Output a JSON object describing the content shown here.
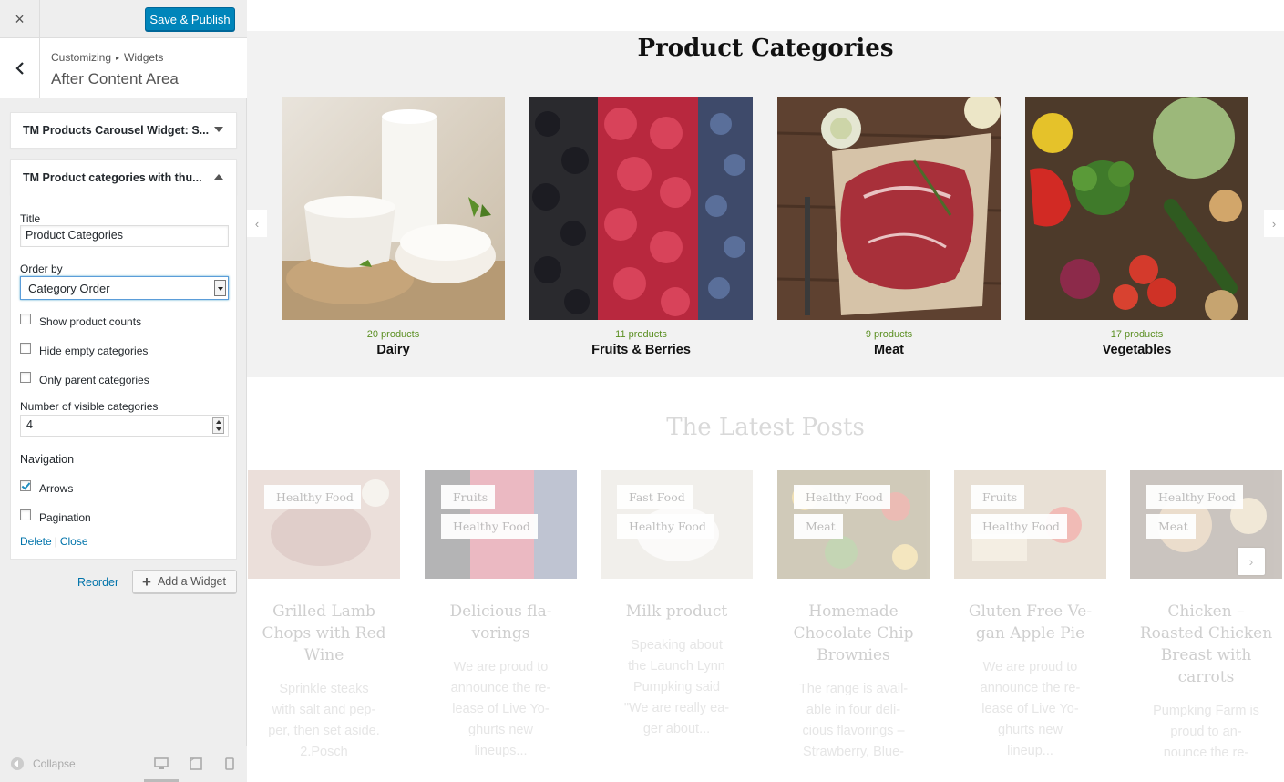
{
  "header": {
    "close_label": "×",
    "publish_label": "Save & Publish"
  },
  "breadcrumb": {
    "root": "Customizing",
    "separator": "▸",
    "current": "Widgets"
  },
  "section_title": "After Content Area",
  "widgets": [
    {
      "title": "TM Products Carousel Widget: S...",
      "state": "collapsed"
    },
    {
      "title": "TM Product categories with thu...",
      "state": "expanded"
    }
  ],
  "form": {
    "title_label": "Title",
    "title_value": "Product Categories",
    "order_label": "Order by",
    "order_value": "Category Order",
    "checkboxes": [
      {
        "label": "Show product counts",
        "checked": false
      },
      {
        "label": "Hide empty categories",
        "checked": false
      },
      {
        "label": "Only parent categories",
        "checked": false
      }
    ],
    "visible_label": "Number of visible categories",
    "visible_value": "4",
    "navigation_heading": "Navigation",
    "nav_checkboxes": [
      {
        "label": "Arrows",
        "checked": true
      },
      {
        "label": "Pagination",
        "checked": false
      }
    ],
    "delete_label": "Delete",
    "link_separator": "|",
    "close_label": "Close"
  },
  "actions": {
    "reorder_label": "Reorder",
    "add_widget_label": "Add a Widget"
  },
  "footer": {
    "collapse_label": "Collapse",
    "devices": [
      "desktop-icon",
      "tablet-icon",
      "mobile-icon"
    ]
  },
  "preview": {
    "categories_title": "Product Categories",
    "categories": [
      {
        "count": "20 products",
        "name": "Dairy",
        "image": "dairy-image"
      },
      {
        "count": "11 products",
        "name": "Fruits & Berries",
        "image": "berries-image"
      },
      {
        "count": "9 products",
        "name": "Meat",
        "image": "meat-image"
      },
      {
        "count": "17 products",
        "name": "Vegetables",
        "image": "vegetables-image"
      }
    ],
    "posts_title": "The Latest Posts",
    "posts": [
      {
        "tags": [
          "Healthy Food"
        ],
        "title": "Grilled Lamb Chops with Red Wine",
        "excerpt": "Sprinkle steaks with salt and pep-per, then set aside. 2.Posch"
      },
      {
        "tags": [
          "Fruits",
          "Healthy Food"
        ],
        "title": "Delicious fla-vorings",
        "excerpt": "We are proud to announce the re-lease of Live Yo-ghurts new lineups..."
      },
      {
        "tags": [
          "Fast Food",
          "Healthy Food"
        ],
        "title": "Milk product",
        "excerpt": "Speaking about the Launch Lynn Pumpking said \"We are really ea-ger about..."
      },
      {
        "tags": [
          "Healthy Food",
          "Meat"
        ],
        "title": "Homemade Chocolate Chip Brownies",
        "excerpt": "The range is avail-able in four deli-cious flavorings – Strawberry, Blue-"
      },
      {
        "tags": [
          "Fruits",
          "Healthy Food"
        ],
        "title": "Gluten Free Ve-gan Apple Pie",
        "excerpt": "We are proud to announce the re-lease of Live Yo-ghurts new lineup..."
      },
      {
        "tags": [
          "Healthy Food",
          "Meat"
        ],
        "title": "Chicken – Roasted Chicken Breast with carrots",
        "excerpt": "Pumpking Farm is proud to an-nounce the re-"
      }
    ]
  },
  "colors": {
    "primary": "#0085ba",
    "link": "#0073aa",
    "count_green": "#5b8f22"
  }
}
